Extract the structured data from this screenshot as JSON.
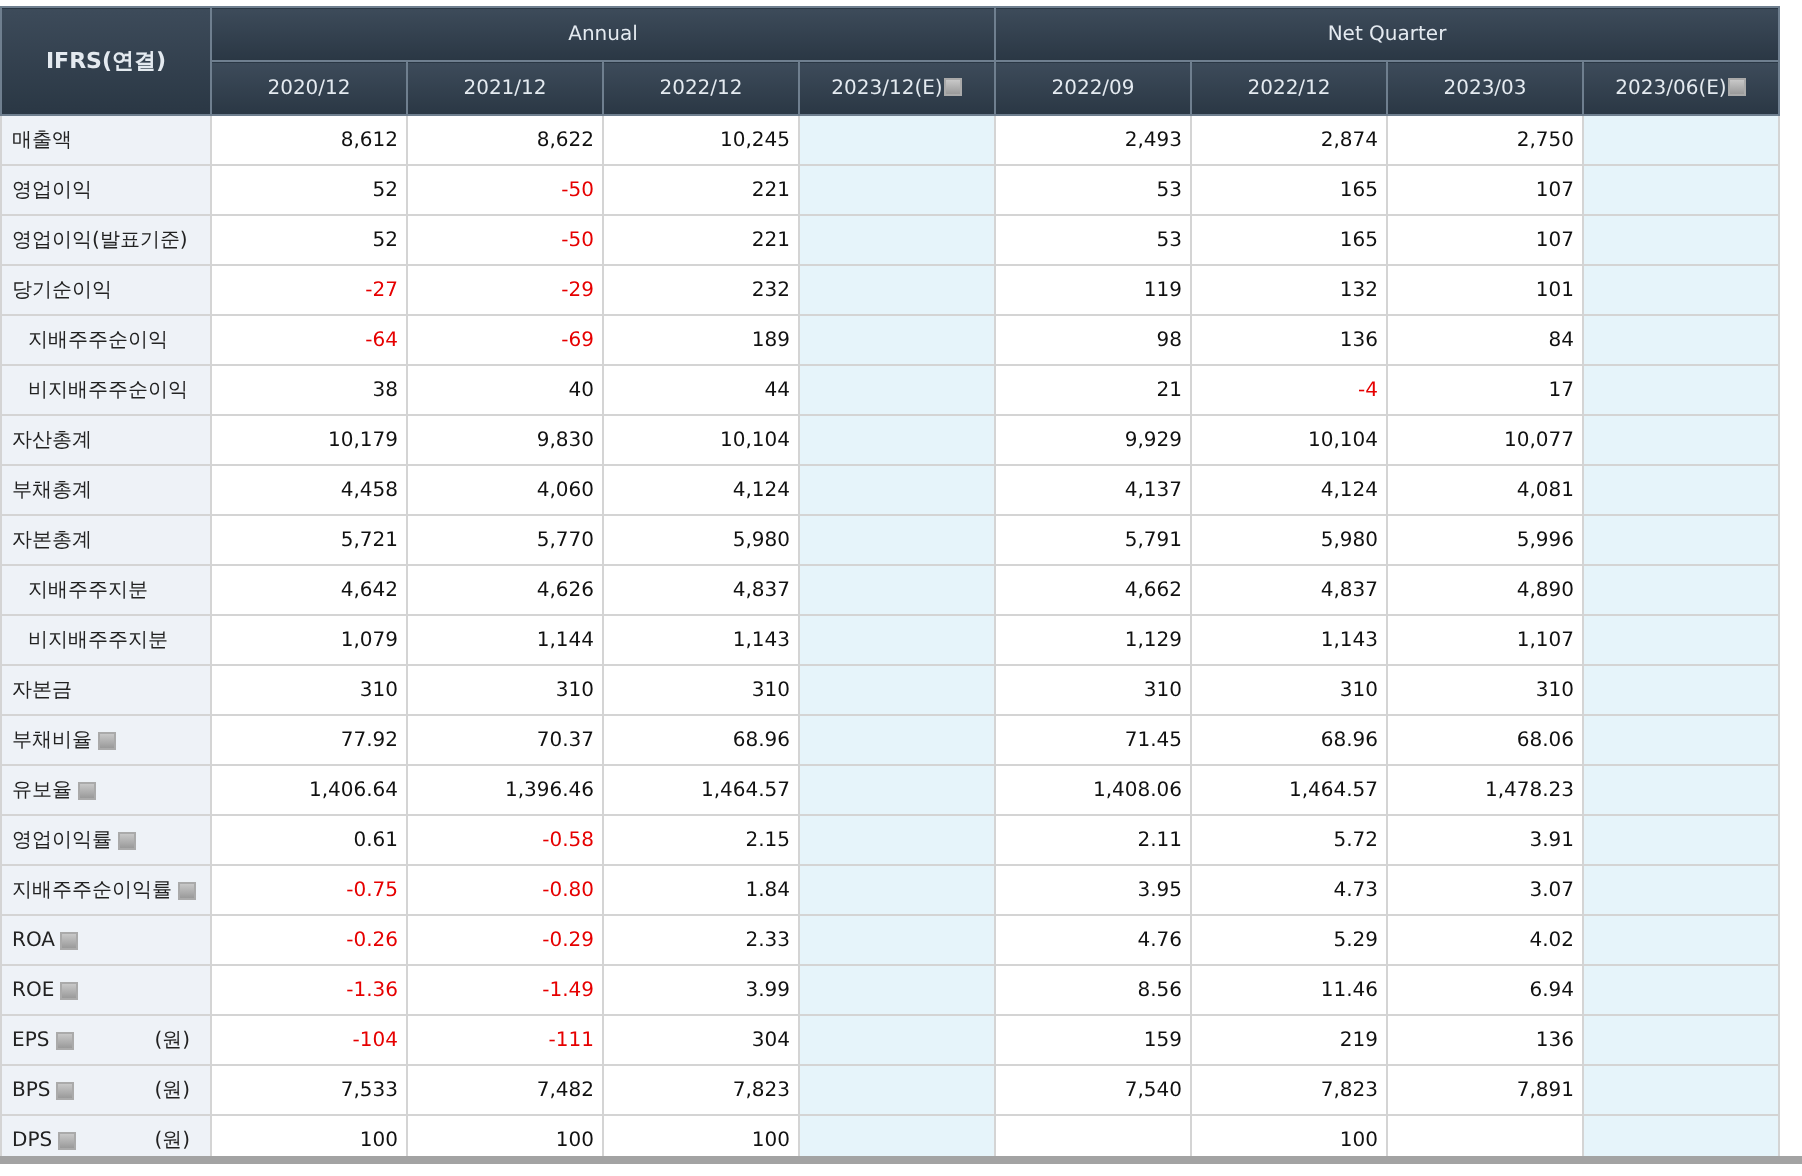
{
  "table": {
    "corner": "IFRS(연결)",
    "groups": [
      {
        "label": "Annual",
        "columns": [
          {
            "label": "2020/12",
            "estimate": false
          },
          {
            "label": "2021/12",
            "estimate": false
          },
          {
            "label": "2022/12",
            "estimate": false
          },
          {
            "label": "2023/12(E)",
            "estimate": true
          }
        ]
      },
      {
        "label": "Net Quarter",
        "columns": [
          {
            "label": "2022/09",
            "estimate": false
          },
          {
            "label": "2022/12",
            "estimate": false
          },
          {
            "label": "2023/03",
            "estimate": false
          },
          {
            "label": "2023/06(E)",
            "estimate": true
          }
        ]
      }
    ],
    "rows": [
      {
        "label": "매출액",
        "kind": "main",
        "help": false,
        "cells": [
          {
            "value": "8,612",
            "negative": false
          },
          {
            "value": "8,622",
            "negative": false
          },
          {
            "value": "10,245",
            "negative": false
          },
          null,
          {
            "value": "2,493",
            "negative": false
          },
          {
            "value": "2,874",
            "negative": false
          },
          {
            "value": "2,750",
            "negative": false
          },
          null
        ]
      },
      {
        "label": "영업이익",
        "kind": "main",
        "help": false,
        "cells": [
          {
            "value": "52",
            "negative": false
          },
          {
            "value": "-50",
            "negative": true
          },
          {
            "value": "221",
            "negative": false
          },
          null,
          {
            "value": "53",
            "negative": false
          },
          {
            "value": "165",
            "negative": false
          },
          {
            "value": "107",
            "negative": false
          },
          null
        ]
      },
      {
        "label": "영업이익(발표기준)",
        "kind": "main",
        "help": false,
        "cells": [
          {
            "value": "52",
            "negative": false
          },
          {
            "value": "-50",
            "negative": true
          },
          {
            "value": "221",
            "negative": false
          },
          null,
          {
            "value": "53",
            "negative": false
          },
          {
            "value": "165",
            "negative": false
          },
          {
            "value": "107",
            "negative": false
          },
          null
        ]
      },
      {
        "label": "당기순이익",
        "kind": "main",
        "help": false,
        "cells": [
          {
            "value": "-27",
            "negative": true
          },
          {
            "value": "-29",
            "negative": true
          },
          {
            "value": "232",
            "negative": false
          },
          null,
          {
            "value": "119",
            "negative": false
          },
          {
            "value": "132",
            "negative": false
          },
          {
            "value": "101",
            "negative": false
          },
          null
        ]
      },
      {
        "label": "지배주주순이익",
        "kind": "sub",
        "help": false,
        "cells": [
          {
            "value": "-64",
            "negative": true
          },
          {
            "value": "-69",
            "negative": true
          },
          {
            "value": "189",
            "negative": false
          },
          null,
          {
            "value": "98",
            "negative": false
          },
          {
            "value": "136",
            "negative": false
          },
          {
            "value": "84",
            "negative": false
          },
          null
        ]
      },
      {
        "label": "비지배주주순이익",
        "kind": "sub",
        "help": false,
        "cells": [
          {
            "value": "38",
            "negative": false
          },
          {
            "value": "40",
            "negative": false
          },
          {
            "value": "44",
            "negative": false
          },
          null,
          {
            "value": "21",
            "negative": false
          },
          {
            "value": "-4",
            "negative": true
          },
          {
            "value": "17",
            "negative": false
          },
          null
        ]
      },
      {
        "label": "자산총계",
        "kind": "main",
        "help": false,
        "cells": [
          {
            "value": "10,179",
            "negative": false
          },
          {
            "value": "9,830",
            "negative": false
          },
          {
            "value": "10,104",
            "negative": false
          },
          null,
          {
            "value": "9,929",
            "negative": false
          },
          {
            "value": "10,104",
            "negative": false
          },
          {
            "value": "10,077",
            "negative": false
          },
          null
        ]
      },
      {
        "label": "부채총계",
        "kind": "main",
        "help": false,
        "cells": [
          {
            "value": "4,458",
            "negative": false
          },
          {
            "value": "4,060",
            "negative": false
          },
          {
            "value": "4,124",
            "negative": false
          },
          null,
          {
            "value": "4,137",
            "negative": false
          },
          {
            "value": "4,124",
            "negative": false
          },
          {
            "value": "4,081",
            "negative": false
          },
          null
        ]
      },
      {
        "label": "자본총계",
        "kind": "main",
        "help": false,
        "cells": [
          {
            "value": "5,721",
            "negative": false
          },
          {
            "value": "5,770",
            "negative": false
          },
          {
            "value": "5,980",
            "negative": false
          },
          null,
          {
            "value": "5,791",
            "negative": false
          },
          {
            "value": "5,980",
            "negative": false
          },
          {
            "value": "5,996",
            "negative": false
          },
          null
        ]
      },
      {
        "label": "지배주주지분",
        "kind": "sub",
        "help": false,
        "cells": [
          {
            "value": "4,642",
            "negative": false
          },
          {
            "value": "4,626",
            "negative": false
          },
          {
            "value": "4,837",
            "negative": false
          },
          null,
          {
            "value": "4,662",
            "negative": false
          },
          {
            "value": "4,837",
            "negative": false
          },
          {
            "value": "4,890",
            "negative": false
          },
          null
        ]
      },
      {
        "label": "비지배주주지분",
        "kind": "sub",
        "help": false,
        "cells": [
          {
            "value": "1,079",
            "negative": false
          },
          {
            "value": "1,144",
            "negative": false
          },
          {
            "value": "1,143",
            "negative": false
          },
          null,
          {
            "value": "1,129",
            "negative": false
          },
          {
            "value": "1,143",
            "negative": false
          },
          {
            "value": "1,107",
            "negative": false
          },
          null
        ]
      },
      {
        "label": "자본금",
        "kind": "main",
        "help": false,
        "cells": [
          {
            "value": "310",
            "negative": false
          },
          {
            "value": "310",
            "negative": false
          },
          {
            "value": "310",
            "negative": false
          },
          null,
          {
            "value": "310",
            "negative": false
          },
          {
            "value": "310",
            "negative": false
          },
          {
            "value": "310",
            "negative": false
          },
          null
        ]
      },
      {
        "label": "부채비율",
        "kind": "main",
        "help": true,
        "cells": [
          {
            "value": "77.92",
            "negative": false
          },
          {
            "value": "70.37",
            "negative": false
          },
          {
            "value": "68.96",
            "negative": false
          },
          null,
          {
            "value": "71.45",
            "negative": false
          },
          {
            "value": "68.96",
            "negative": false
          },
          {
            "value": "68.06",
            "negative": false
          },
          null
        ]
      },
      {
        "label": "유보율",
        "kind": "main",
        "help": true,
        "cells": [
          {
            "value": "1,406.64",
            "negative": false
          },
          {
            "value": "1,396.46",
            "negative": false
          },
          {
            "value": "1,464.57",
            "negative": false
          },
          null,
          {
            "value": "1,408.06",
            "negative": false
          },
          {
            "value": "1,464.57",
            "negative": false
          },
          {
            "value": "1,478.23",
            "negative": false
          },
          null
        ]
      },
      {
        "label": "영업이익률",
        "kind": "main",
        "help": true,
        "cells": [
          {
            "value": "0.61",
            "negative": false
          },
          {
            "value": "-0.58",
            "negative": true
          },
          {
            "value": "2.15",
            "negative": false
          },
          null,
          {
            "value": "2.11",
            "negative": false
          },
          {
            "value": "5.72",
            "negative": false
          },
          {
            "value": "3.91",
            "negative": false
          },
          null
        ]
      },
      {
        "label": "지배주주순이익률",
        "kind": "main",
        "help": true,
        "cells": [
          {
            "value": "-0.75",
            "negative": true
          },
          {
            "value": "-0.80",
            "negative": true
          },
          {
            "value": "1.84",
            "negative": false
          },
          null,
          {
            "value": "3.95",
            "negative": false
          },
          {
            "value": "4.73",
            "negative": false
          },
          {
            "value": "3.07",
            "negative": false
          },
          null
        ]
      },
      {
        "label": "ROA",
        "kind": "main",
        "help": true,
        "cells": [
          {
            "value": "-0.26",
            "negative": true
          },
          {
            "value": "-0.29",
            "negative": true
          },
          {
            "value": "2.33",
            "negative": false
          },
          null,
          {
            "value": "4.76",
            "negative": false
          },
          {
            "value": "5.29",
            "negative": false
          },
          {
            "value": "4.02",
            "negative": false
          },
          null
        ]
      },
      {
        "label": "ROE",
        "kind": "main",
        "help": true,
        "cells": [
          {
            "value": "-1.36",
            "negative": true
          },
          {
            "value": "-1.49",
            "negative": true
          },
          {
            "value": "3.99",
            "negative": false
          },
          null,
          {
            "value": "8.56",
            "negative": false
          },
          {
            "value": "11.46",
            "negative": false
          },
          {
            "value": "6.94",
            "negative": false
          },
          null
        ]
      },
      {
        "label": "EPS",
        "kind": "main",
        "help": true,
        "unit": "(원)",
        "cells": [
          {
            "value": "-104",
            "negative": true
          },
          {
            "value": "-111",
            "negative": true
          },
          {
            "value": "304",
            "negative": false
          },
          null,
          {
            "value": "159",
            "negative": false
          },
          {
            "value": "219",
            "negative": false
          },
          {
            "value": "136",
            "negative": false
          },
          null
        ]
      },
      {
        "label": "BPS",
        "kind": "main",
        "help": true,
        "unit": "(원)",
        "cells": [
          {
            "value": "7,533",
            "negative": false
          },
          {
            "value": "7,482",
            "negative": false
          },
          {
            "value": "7,823",
            "negative": false
          },
          null,
          {
            "value": "7,540",
            "negative": false
          },
          {
            "value": "7,823",
            "negative": false
          },
          {
            "value": "7,891",
            "negative": false
          },
          null
        ]
      },
      {
        "label": "DPS",
        "kind": "main",
        "help": true,
        "unit": "(원)",
        "cells": [
          {
            "value": "100",
            "negative": false
          },
          {
            "value": "100",
            "negative": false
          },
          {
            "value": "100",
            "negative": false
          },
          null,
          null,
          {
            "value": "100",
            "negative": false
          },
          null,
          null
        ]
      }
    ]
  }
}
